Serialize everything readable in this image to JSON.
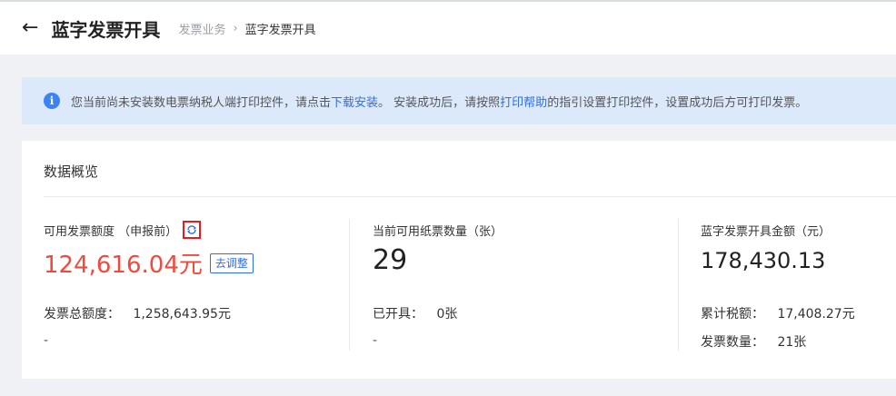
{
  "header": {
    "title": "蓝字发票开具",
    "breadcrumb": [
      "发票业务",
      "蓝字发票开具"
    ]
  },
  "notice": {
    "text_before": "您当前尚未安装数电票纳税人端打印控件，请点击",
    "download_link": "下载安装",
    "text_middle": "。 安装成功后，请按照",
    "help_link": "打印帮助",
    "text_after": "的指引设置打印控件，设置成功后方可打印发票。"
  },
  "overview": {
    "title": "数据概览",
    "quota": {
      "label": "可用发票额度 （申报前）",
      "value": "124,616.04元",
      "adjust_label": "去调整",
      "total_label": "发票总额度：",
      "total_value": "1,258,643.95元",
      "extra": "-"
    },
    "paper": {
      "label": "当前可用纸票数量（张）",
      "value": "29",
      "issued_label": "已开具：",
      "issued_value": "0张",
      "extra": "-"
    },
    "amount": {
      "label": "蓝字发票开具金额（元）",
      "value": "178,430.13",
      "tax_label": "累计税额：",
      "tax_value": "17,408.27元",
      "count_label": "发票数量：",
      "count_value": "21张"
    }
  },
  "colors": {
    "accent": "#2f6fe0",
    "danger": "#f0493e",
    "notice_bg": "#dce9fb"
  }
}
